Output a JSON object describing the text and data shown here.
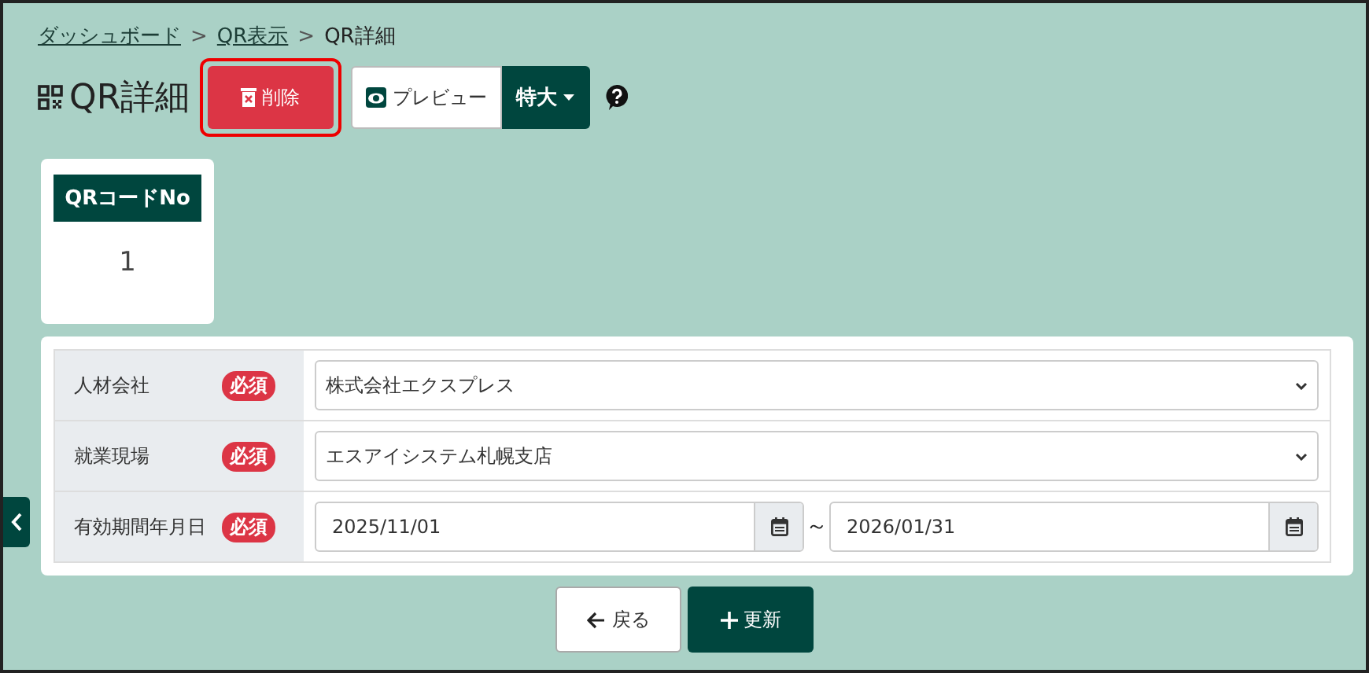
{
  "breadcrumb": [
    {
      "kind": "link",
      "label": "ダッシュボード"
    },
    {
      "kind": "separator",
      "label": ">"
    },
    {
      "kind": "link",
      "label": "QR表示"
    },
    {
      "kind": "separator",
      "label": ">"
    },
    {
      "kind": "current",
      "label": "QR詳細"
    }
  ],
  "title": "QR詳細",
  "delete_button": {
    "label": "削除",
    "highlighted": true
  },
  "preview_button": {
    "label": "プレビュー"
  },
  "size_dropdown": {
    "label": "特大"
  },
  "qr_card": {
    "header": "QRコードNo",
    "value": "1"
  },
  "form": {
    "rows": [
      {
        "kind": "select",
        "label": "人材会社",
        "badge": "必須",
        "value": "株式会社エクスプレス"
      },
      {
        "kind": "select",
        "label": "就業現場",
        "badge": "必須",
        "value": "エスアイシステム札幌支店"
      },
      {
        "kind": "date_range",
        "label": "有効期間年月日",
        "badge": "必須",
        "from": "2025/11/01",
        "separator": "～",
        "to": "2026/01/31"
      }
    ]
  },
  "back_button": {
    "label": "戻る"
  },
  "update_button": {
    "label": "更新"
  }
}
